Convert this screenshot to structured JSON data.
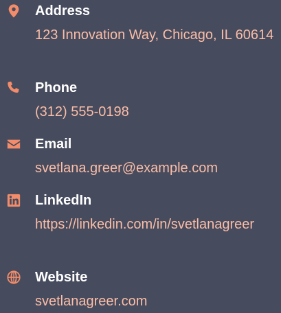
{
  "accent_color": "#f28c6a",
  "text_color": "#fbbda7",
  "label_color": "#ffffff",
  "background_color": "#464b5d",
  "contacts": [
    {
      "icon": "map-pin-icon",
      "label": "Address",
      "value": "123 Innovation Way, Chicago, IL 60614"
    },
    {
      "icon": "phone-icon",
      "label": "Phone",
      "value": "(312) 555-0198"
    },
    {
      "icon": "envelope-icon",
      "label": "Email",
      "value": "svetlana.greer@example.com"
    },
    {
      "icon": "linkedin-icon",
      "label": "LinkedIn",
      "value": "https://linkedin.com/in/svetlanagreer"
    },
    {
      "icon": "globe-icon",
      "label": "Website",
      "value": "svetlanagreer.com"
    }
  ]
}
